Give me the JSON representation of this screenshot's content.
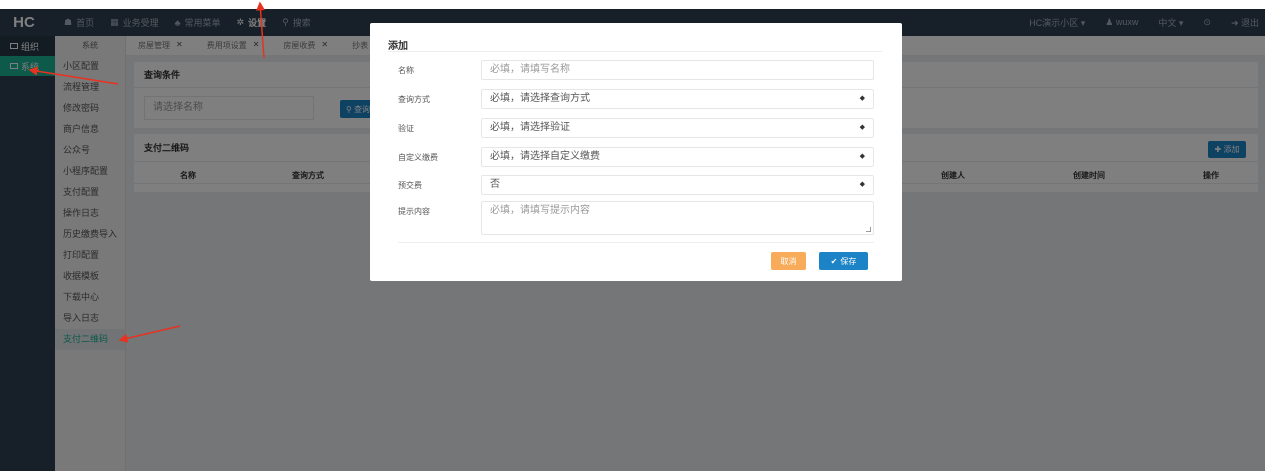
{
  "header": {
    "logo": "HC",
    "nav": [
      {
        "icon": "home-icon",
        "glyph": "☗",
        "label": "首页"
      },
      {
        "icon": "business-icon",
        "glyph": "▦",
        "label": "业务受理"
      },
      {
        "icon": "menu-icon",
        "glyph": "♣",
        "label": "常用菜单"
      },
      {
        "icon": "gear-icon",
        "glyph": "✲",
        "label": "设置"
      },
      {
        "icon": "search-icon",
        "glyph": "⚲",
        "label": "搜索"
      }
    ],
    "right": [
      {
        "label": "HC演示小区 ▾"
      },
      {
        "label": "♟ wuxw"
      },
      {
        "label": "中文 ▾"
      },
      {
        "label": "⊙"
      },
      {
        "label": "➜ 退出"
      }
    ]
  },
  "sidebar": [
    {
      "label": "组织"
    },
    {
      "label": "系统"
    }
  ],
  "submenu": {
    "title": "系统",
    "items": [
      "小区配置",
      "流程管理",
      "修改密码",
      "商户信息",
      "公众号",
      "小程序配置",
      "支付配置",
      "操作日志",
      "历史缴费导入",
      "打印配置",
      "收据模板",
      "下载中心",
      "导入日志",
      "支付二维码"
    ]
  },
  "tabs": [
    "房屋管理",
    "费用项设置",
    "房屋收费",
    "抄表"
  ],
  "query": {
    "title": "查询条件",
    "placeholder": "请选择名称",
    "button": "查询"
  },
  "table": {
    "title": "支付二维码",
    "add": "添加",
    "columns": [
      "名称",
      "查询方式",
      "创建人",
      "创建时间",
      "操作"
    ]
  },
  "modal": {
    "title": "添加",
    "fields": [
      {
        "label": "名称",
        "value": "必填，请填写名称",
        "type": "input"
      },
      {
        "label": "查询方式",
        "value": "必填，请选择查询方式",
        "type": "select"
      },
      {
        "label": "验证",
        "value": "必填，请选择验证",
        "type": "select"
      },
      {
        "label": "自定义缴费",
        "value": "必填，请选择自定义缴费",
        "type": "select"
      },
      {
        "label": "预交费",
        "value": "否",
        "type": "select"
      },
      {
        "label": "提示内容",
        "value": "必填，请填写提示内容",
        "type": "textarea"
      }
    ],
    "cancel": "取消",
    "save": "保存"
  },
  "colors": {
    "header_bg": "#2f4050",
    "accent": "#1ab394",
    "primary": "#1c84c6",
    "warning": "#f8ac59",
    "annotation": "#e8321f"
  }
}
